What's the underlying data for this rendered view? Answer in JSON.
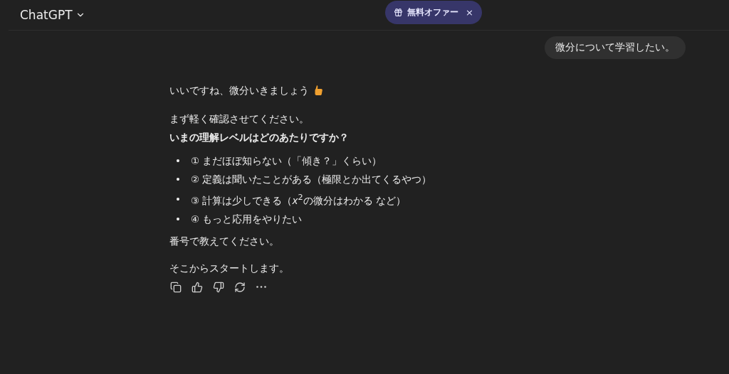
{
  "header": {
    "title": "ChatGPT",
    "offer": {
      "label": "無料オファー",
      "close": "×"
    }
  },
  "user_message": "微分について学習したい。",
  "assistant": {
    "greeting": "いいですね、微分いきましょう",
    "intro": "まず軽く確認させてください。",
    "question": "いまの理解レベルはどのあたりですか？",
    "options": [
      {
        "marker": "•",
        "text": "① まだほぼ知らない（「傾き？」くらい）"
      },
      {
        "marker": "•",
        "text": "② 定義は聞いたことがある（極限とか出てくるやつ）"
      },
      {
        "marker": "•",
        "text": "③ 計算は少しできる（*x*$^{2}$の微分はわかる など）"
      },
      {
        "marker": "•",
        "text": "④ もっと応用をやりたい"
      }
    ],
    "prompt": "番号で教えてください。",
    "closing": "そこからスタートします。"
  }
}
